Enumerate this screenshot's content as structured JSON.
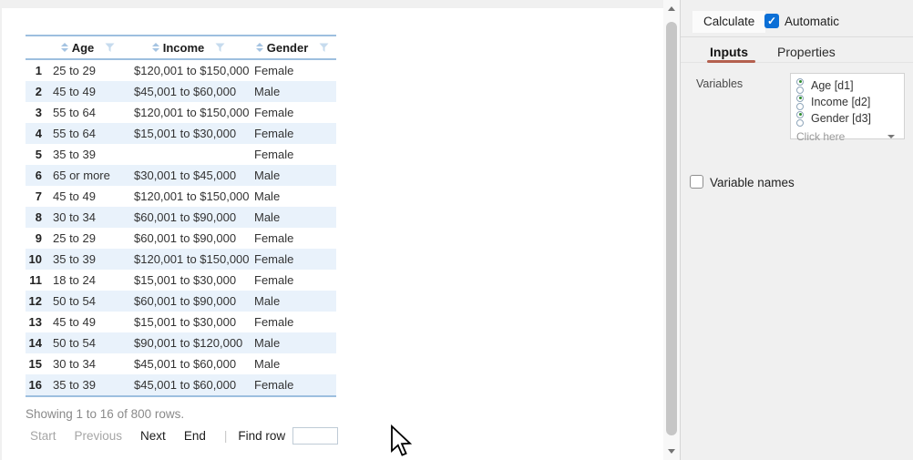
{
  "table": {
    "headers": [
      {
        "label": "Age"
      },
      {
        "label": "Income"
      },
      {
        "label": "Gender"
      }
    ],
    "rows": [
      {
        "num": "1",
        "age": "25 to 29",
        "income": "$120,001 to $150,000",
        "gender": "Female"
      },
      {
        "num": "2",
        "age": "45 to 49",
        "income": "$45,001 to $60,000",
        "gender": "Male"
      },
      {
        "num": "3",
        "age": "55 to 64",
        "income": "$120,001 to $150,000",
        "gender": "Female"
      },
      {
        "num": "4",
        "age": "55 to 64",
        "income": "$15,001 to $30,000",
        "gender": "Female"
      },
      {
        "num": "5",
        "age": "35 to 39",
        "income": "",
        "gender": "Female"
      },
      {
        "num": "6",
        "age": "65 or more",
        "income": "$30,001 to $45,000",
        "gender": "Male"
      },
      {
        "num": "7",
        "age": "45 to 49",
        "income": "$120,001 to $150,000",
        "gender": "Male"
      },
      {
        "num": "8",
        "age": "30 to 34",
        "income": "$60,001 to $90,000",
        "gender": "Male"
      },
      {
        "num": "9",
        "age": "25 to 29",
        "income": "$60,001 to $90,000",
        "gender": "Female"
      },
      {
        "num": "10",
        "age": "35 to 39",
        "income": "$120,001 to $150,000",
        "gender": "Female"
      },
      {
        "num": "11",
        "age": "18 to 24",
        "income": "$15,001 to $30,000",
        "gender": "Female"
      },
      {
        "num": "12",
        "age": "50 to 54",
        "income": "$60,001 to $90,000",
        "gender": "Male"
      },
      {
        "num": "13",
        "age": "45 to 49",
        "income": "$15,001 to $30,000",
        "gender": "Female"
      },
      {
        "num": "14",
        "age": "50 to 54",
        "income": "$90,001 to $120,000",
        "gender": "Male"
      },
      {
        "num": "15",
        "age": "30 to 34",
        "income": "$45,001 to $60,000",
        "gender": "Male"
      },
      {
        "num": "16",
        "age": "35 to 39",
        "income": "$45,001 to $60,000",
        "gender": "Female"
      }
    ],
    "summary": "Showing 1 to 16 of 800 rows.",
    "pagination": {
      "start": "Start",
      "previous": "Previous",
      "next": "Next",
      "end": "End",
      "divider": "|",
      "find_label": "Find row",
      "find_value": ""
    }
  },
  "panel": {
    "calculate_label": "Calculate",
    "automatic_label": "Automatic",
    "automatic_checked": true,
    "check_glyph": "✓",
    "tabs": {
      "inputs": "Inputs",
      "properties": "Properties",
      "active": "Inputs"
    },
    "variables_label": "Variables",
    "variables": [
      "Age [d1]",
      "Income [d2]",
      "Gender [d3]"
    ],
    "dropdown_placeholder": "Click here",
    "variable_names_label": "Variable names",
    "variable_names_checked": false
  },
  "colors": {
    "table_border_blue": "#9dbfdf",
    "row_stripe": "#e9f2fb",
    "panel_bg": "#f0f0f0",
    "tab_accent": "#b4604f",
    "checkbox_blue": "#0b6fd6",
    "radio_selected_green": "#2e8b2e"
  }
}
